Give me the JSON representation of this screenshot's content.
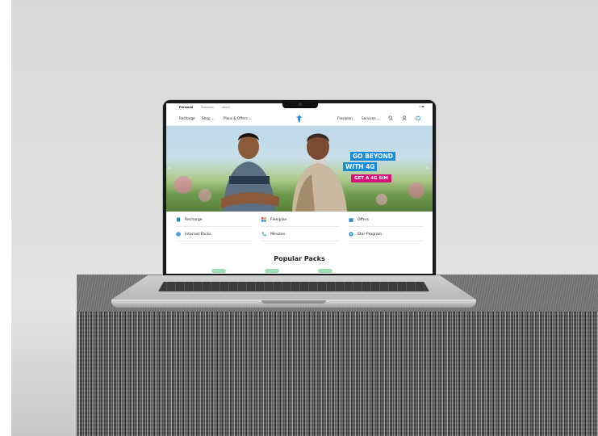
{
  "topbar": {
    "tabs": [
      "Personal",
      "Business",
      "About"
    ]
  },
  "nav": {
    "recharge": "Recharge",
    "shop": "Shop ⌄",
    "plans": "Plans & Offers ⌄",
    "flexiplan": "Flexiplan",
    "services": "Services ⌄"
  },
  "hero": {
    "line1": "GO BEYOND",
    "line2": "WITH 4G",
    "cta": "GET A 4G SIM"
  },
  "quick_links": [
    {
      "label": "Recharge",
      "icon": "sim-card-icon",
      "color": "#1a8bd6"
    },
    {
      "label": "Flexiplan",
      "icon": "grid-icon",
      "color": "#e84e7a"
    },
    {
      "label": "Offers",
      "icon": "gift-icon",
      "color": "#1a8bd6"
    },
    {
      "label": "Internet Packs",
      "icon": "globe-icon",
      "color": "#1a8bd6"
    },
    {
      "label": "Minutes",
      "icon": "phone-icon",
      "color": "#1a8bd6"
    },
    {
      "label": "Star Program",
      "icon": "star-gear-icon",
      "color": "#1a8bd6"
    }
  ],
  "popular": {
    "title": "Popular Packs"
  },
  "colors": {
    "brand_blue": "#1a8bd6",
    "pink": "#d8127b"
  }
}
